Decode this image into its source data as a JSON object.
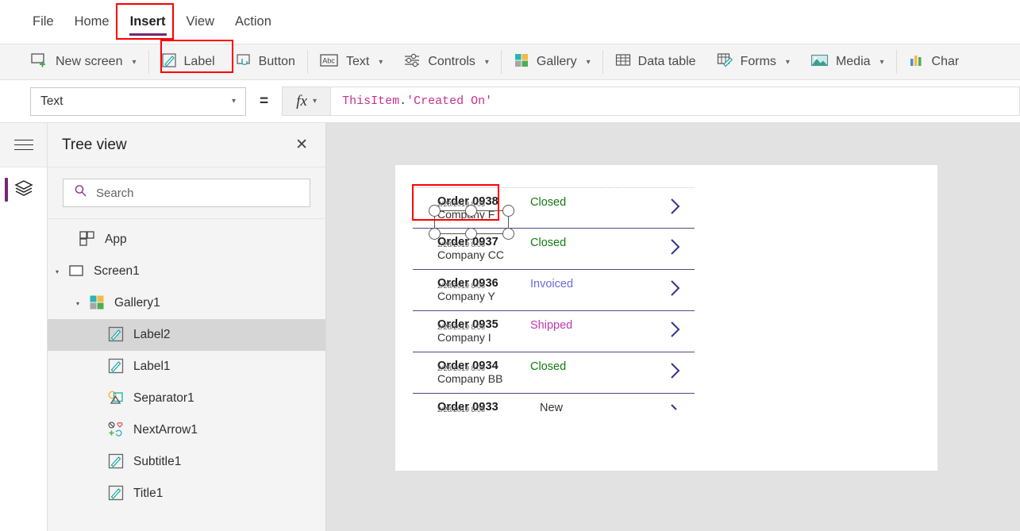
{
  "menu": {
    "tabs": [
      {
        "label": "File",
        "active": false
      },
      {
        "label": "Home",
        "active": false
      },
      {
        "label": "Insert",
        "active": true
      },
      {
        "label": "View",
        "active": false
      },
      {
        "label": "Action",
        "active": false
      }
    ]
  },
  "ribbon": {
    "items": [
      {
        "label": "New screen",
        "icon": "new-screen-icon",
        "caret": true
      },
      {
        "label": "Label",
        "icon": "label-icon",
        "caret": false
      },
      {
        "label": "Button",
        "icon": "button-icon",
        "caret": false
      },
      {
        "label": "Text",
        "icon": "text-abc-icon",
        "caret": true
      },
      {
        "label": "Controls",
        "icon": "controls-sliders-icon",
        "caret": true
      },
      {
        "label": "Gallery",
        "icon": "gallery-grid-icon",
        "caret": true
      },
      {
        "label": "Data table",
        "icon": "data-table-icon",
        "caret": false
      },
      {
        "label": "Forms",
        "icon": "forms-icon",
        "caret": true
      },
      {
        "label": "Media",
        "icon": "media-image-icon",
        "caret": true
      },
      {
        "label": "Char",
        "icon": "charts-icon",
        "caret": false
      }
    ]
  },
  "formula_bar": {
    "property": "Text",
    "equals": "=",
    "fx_label": "fx",
    "formula_tokens": [
      {
        "text": "ThisItem",
        "type": "pink"
      },
      {
        "text": ".",
        "type": "dark"
      },
      {
        "text": "'Created On'",
        "type": "pink"
      }
    ]
  },
  "tree_view": {
    "title": "Tree view",
    "close_label": "✕",
    "search_placeholder": "Search",
    "search_value": "",
    "items": [
      {
        "label": "App",
        "icon": "app-icon",
        "indent": 0,
        "expander": "",
        "selected": false
      },
      {
        "label": "Screen1",
        "icon": "screen-icon",
        "indent": 1,
        "expander": "▾",
        "selected": false
      },
      {
        "label": "Gallery1",
        "icon": "gallery-grid-icon",
        "indent": 2,
        "expander": "▾",
        "selected": false
      },
      {
        "label": "Label2",
        "icon": "label-icon",
        "indent": 3,
        "expander": "",
        "selected": true
      },
      {
        "label": "Label1",
        "icon": "label-icon",
        "indent": 3,
        "expander": "",
        "selected": false
      },
      {
        "label": "Separator1",
        "icon": "separator-shape-icon",
        "indent": 3,
        "expander": "",
        "selected": false
      },
      {
        "label": "NextArrow1",
        "icon": "next-arrow-icons-icon",
        "indent": 3,
        "expander": "",
        "selected": false
      },
      {
        "label": "Subtitle1",
        "icon": "label-icon",
        "indent": 3,
        "expander": "",
        "selected": false
      },
      {
        "label": "Title1",
        "icon": "label-icon",
        "indent": 3,
        "expander": "",
        "selected": false
      }
    ]
  },
  "canvas": {
    "gallery": {
      "overlay_date": "2/28/2019 8:05",
      "rows": [
        {
          "title": "Order 0938",
          "subtitle": "Company F",
          "status": "Closed",
          "status_color": "#107c10",
          "selected": true
        },
        {
          "title": "Order 0937",
          "subtitle": "Company CC",
          "status": "Closed",
          "status_color": "#107c10",
          "selected": false
        },
        {
          "title": "Order 0936",
          "subtitle": "Company Y",
          "status": "Invoiced",
          "status_color": "#6b6bd6",
          "selected": false
        },
        {
          "title": "Order 0935",
          "subtitle": "Company I",
          "status": "Shipped",
          "status_color": "#c239b3",
          "selected": false
        },
        {
          "title": "Order 0934",
          "subtitle": "Company BB",
          "status": "Closed",
          "status_color": "#107c10",
          "selected": false
        },
        {
          "title": "Order 0933",
          "subtitle": "",
          "status": "New",
          "status_color": "#333333",
          "selected": false
        }
      ]
    }
  },
  "colors": {
    "brand_purple": "#742774",
    "annotation_red": "#ff0000",
    "ribbon_bg": "#f4f4f4",
    "canvas_bg": "#e2e2e2"
  }
}
